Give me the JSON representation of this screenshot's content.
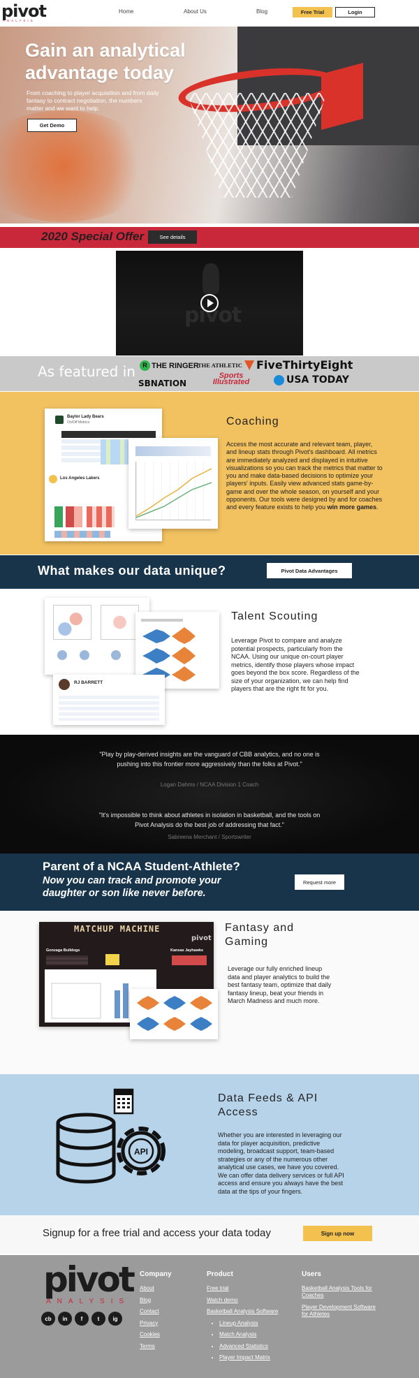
{
  "nav": {
    "logo": "pivot",
    "logo_sub": "ANALYSIS",
    "links": [
      "Home",
      "About Us",
      "Blog"
    ],
    "trial_label": "Free Trial",
    "login_label": "Login"
  },
  "hero": {
    "title": "Gain an analytical advantage today",
    "text": "From coaching to player acquisition and from daily fantasy to contract negotiation, the numbers matter and we want to help.",
    "cta": "Get Demo"
  },
  "offer": {
    "text": "2020 Special Offer",
    "cta": "See details"
  },
  "video": {
    "logo": "pivot"
  },
  "featured": {
    "label": "As featured in",
    "publications": [
      "THE RINGER",
      "THE ATHLETIC",
      "FiveThirtyEight",
      "SBNATION",
      "Sports Illustrated",
      "USA TODAY"
    ]
  },
  "coaching": {
    "title": "Coaching",
    "text": "Access the most accurate and relevant team, player, and lineup stats through Pivot's dashboard. All metrics are immediately analyzed and displayed in intuitive visualizations so you can track the metrics that matter to you and make data-based decisions to optimize your players' inputs. Easily view advanced stats game-by-game and over the whole season, on yourself and your opponents. Our tools were designed by and for coaches and every feature exists to help you ",
    "text_bold": "win more games",
    "text_end": ".",
    "mock_team1": "Baylor Lady Bears",
    "mock_team1_sub": "On/Off Metrics",
    "mock_team2": "Los Angeles Lakers"
  },
  "unique": {
    "title": "What makes our data unique?",
    "cta": "Pivot Data Advantages"
  },
  "talent": {
    "title": "Talent Scouting",
    "text": "Leverage Pivot to compare and analyze potential prospects, particularly from the NCAA. Using our unique on-court player metrics, identify those players whose impact goes beyond the box score. Regardless of the size of your organization, we can help find players that are the right fit for you.",
    "mock_player": "RJ BARRETT"
  },
  "quotes": [
    {
      "text": "\"Play by play-derived insights are the vanguard of CBB analytics, and no one is pushing into this frontier more aggressively than the folks at Pivot.\"",
      "author": "Logan Dahms / NCAA Division 1 Coach"
    },
    {
      "text": "\"It's impossible to think about athletes in isolation in basketball, and the tools on Pivot Analysis do the best job of addressing that fact.\"",
      "author": "Sabreena Merchant / Sportswriter"
    }
  ],
  "parent": {
    "title": "Parent of a NCAA Student-Athlete?",
    "subtitle": "Now you can track and promote your daughter or son like never before.",
    "cta": "Request more"
  },
  "fantasy": {
    "title": "Fantasy and Gaming",
    "text": "Leverage our fully enriched lineup data and player analytics to build the best fantasy team, optimize that daily fantasy lineup, beat your friends in March Madness and much more.",
    "mock_header": "MATCHUP MACHINE",
    "mock_logo": "pivot",
    "mock_team_left": "Gonzaga Bulldogs",
    "mock_team_right": "Kansas Jayhawks"
  },
  "feeds": {
    "title": "Data Feeds & API Access",
    "text": "Whether you are interested in leveraging our data for player acquisition, predictive modeling, broadcast support, team-based strategies or any of the numerous other analytical use cases, we have you covered. We can offer data delivery services or full API access and ensure you always have the best data at the tips of your fingers.",
    "icon_label": "API"
  },
  "signup": {
    "text": "Signup for a free trial and access your data today",
    "cta": "Sign up now"
  },
  "footer": {
    "logo": "pivot",
    "logo_sub": "ANALYSIS",
    "socials": [
      "cb",
      "in",
      "f",
      "t",
      "ig"
    ],
    "company": {
      "title": "Company",
      "links": [
        "About",
        "Blog",
        "Contact",
        "Privacy",
        "Cookies",
        "Terms"
      ]
    },
    "product": {
      "title": "Product",
      "links": [
        "Free trial",
        "Watch demo",
        "Basketball Analysis Software"
      ],
      "sublinks": [
        "Lineup Analysis",
        "Match Analysis",
        "Advanced Statistics",
        "Player Impact Matrix"
      ]
    },
    "users": {
      "title": "Users",
      "links": [
        "Basketball Analysis Tools for Coaches",
        "Player Development Software for Athletes"
      ]
    }
  },
  "colors": {
    "gold": "#f2c160",
    "navy": "#17344a",
    "red": "#c8283a",
    "light_blue": "#b6d3ea",
    "footer_gray": "#9b9b9b"
  }
}
